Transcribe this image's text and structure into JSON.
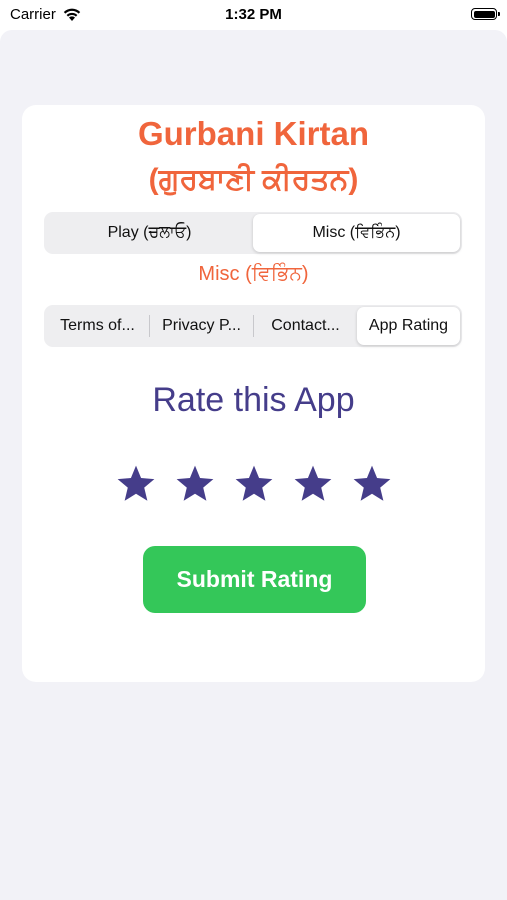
{
  "status_bar": {
    "carrier": "Carrier",
    "time": "1:32 PM"
  },
  "header": {
    "title_en": "Gurbani Kirtan",
    "title_pa": "(ਗੁਰਬਾਣੀ ਕੀਰਤਨ)"
  },
  "main_tabs": [
    {
      "label": "Play (ਚਲਾਓ)",
      "selected": false
    },
    {
      "label": "Misc (ਵਿਭਿੰਨ)",
      "selected": true
    }
  ],
  "section_label": "Misc (ਵਿਭਿੰਨ)",
  "sub_tabs": [
    {
      "label": "Terms of...",
      "selected": false
    },
    {
      "label": "Privacy P...",
      "selected": false
    },
    {
      "label": "Contact...",
      "selected": false
    },
    {
      "label": "App Rating",
      "selected": true
    }
  ],
  "rating": {
    "title": "Rate this App",
    "max_stars": 5,
    "value": 5,
    "star_color": "#453d8a",
    "star_icon": "star-icon"
  },
  "submit_button": {
    "label": "Submit Rating",
    "color": "#34c759"
  },
  "colors": {
    "accent": "#f0653c",
    "heading": "#453d8a"
  }
}
